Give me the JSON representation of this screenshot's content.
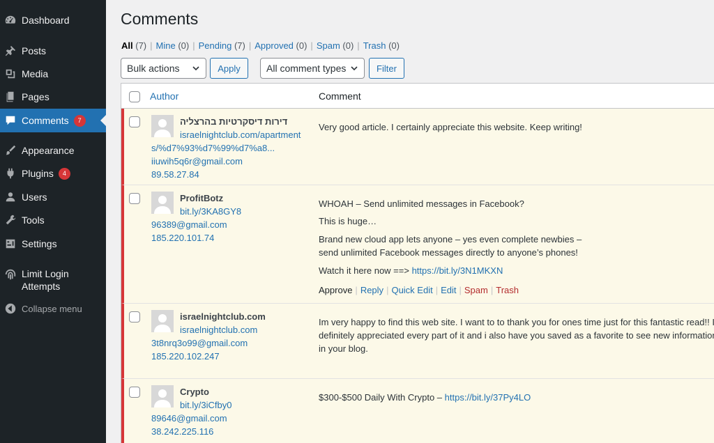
{
  "sidebar": {
    "items": [
      {
        "label": "Dashboard",
        "icon": "dashboard-icon"
      },
      {
        "label": "Posts",
        "icon": "pin-icon"
      },
      {
        "label": "Media",
        "icon": "media-icon"
      },
      {
        "label": "Pages",
        "icon": "pages-icon"
      },
      {
        "label": "Comments",
        "icon": "comment-icon",
        "badge": "7"
      },
      {
        "label": "Appearance",
        "icon": "paintbrush-icon"
      },
      {
        "label": "Plugins",
        "icon": "plugin-icon",
        "badge": "4"
      },
      {
        "label": "Users",
        "icon": "users-icon"
      },
      {
        "label": "Tools",
        "icon": "wrench-icon"
      },
      {
        "label": "Settings",
        "icon": "settings-icon"
      },
      {
        "label": "Limit Login Attempts",
        "icon": "fingerprint-icon"
      },
      {
        "label": "Collapse menu",
        "icon": "collapse-icon"
      }
    ]
  },
  "page": {
    "title": "Comments"
  },
  "filters": [
    {
      "label": "All",
      "count": "(7)"
    },
    {
      "label": "Mine",
      "count": "(0)"
    },
    {
      "label": "Pending",
      "count": "(7)"
    },
    {
      "label": "Approved",
      "count": "(0)"
    },
    {
      "label": "Spam",
      "count": "(0)"
    },
    {
      "label": "Trash",
      "count": "(0)"
    }
  ],
  "toolbar": {
    "bulk_actions": "Bulk actions",
    "apply": "Apply",
    "comment_types": "All comment types",
    "filter": "Filter"
  },
  "table": {
    "col_author": "Author",
    "col_comment": "Comment"
  },
  "comments": [
    {
      "name": "דירות דיסקרטיות בהרצליה",
      "url_line1": "israelnightclub.com/apartment",
      "url_line2": "s/%d7%93%d7%99%d7%a8...",
      "email": "iiuwih5q6r@gmail.com",
      "ip": "89.58.27.84",
      "text": "Very good article. I certainly appreciate this website. Keep writing!"
    },
    {
      "name": "ProfitBotz",
      "url_line1": "bit.ly/3KA8GY8",
      "email": "96389@gmail.com",
      "ip": "185.220.101.74",
      "p1": "WHOAH – Send unlimited messages in Facebook?",
      "p2": "This is huge…",
      "p3": "Brand new cloud app lets anyone – yes even complete newbies – send unlimited Facebook messages directly to anyone’s phones!",
      "p4_prefix": "Watch it here now ==> ",
      "p4_link": "https://bit.ly/3N1MKXN",
      "actions": {
        "approve": "Approve",
        "reply": "Reply",
        "quick_edit": "Quick Edit",
        "edit": "Edit",
        "spam": "Spam",
        "trash": "Trash"
      }
    },
    {
      "name": "israelnightclub.com",
      "url_line1": "israelnightclub.com",
      "email": "3t8nrq3o99@gmail.com",
      "ip": "185.220.102.247",
      "text": "Im very happy to find this web site. I want to to thank you for ones time just for this fantastic read!! I definitely appreciated every part of it and i also have you saved as a favorite to see new information in your blog."
    },
    {
      "name": "Crypto",
      "url_line1": "bit.ly/3iCfby0",
      "email": "89646@gmail.com",
      "ip": "38.242.225.116",
      "text_prefix": "$300-$500 Daily With Crypto – ",
      "link": "https://bit.ly/37Py4LO"
    }
  ],
  "colors": {
    "sidebar_bg": "#1d2327",
    "accent": "#2271b1",
    "pending_bg": "#fcf9e8",
    "pending_border": "#d63638"
  }
}
